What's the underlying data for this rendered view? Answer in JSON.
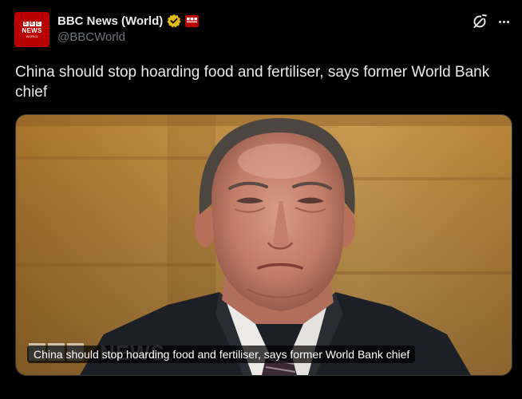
{
  "account": {
    "avatar_blocks": [
      "B",
      "B",
      "C"
    ],
    "avatar_news": "NEWS",
    "avatar_world": "WORLD",
    "display_name": "BBC News (World)",
    "handle": "@BBCWorld"
  },
  "post": {
    "text": "China should stop hoarding food and fertiliser, says former World Bank chief"
  },
  "media": {
    "caption": "China should stop hoarding food and fertiliser, says former World Bank chief",
    "watermark": "NEWS"
  },
  "icons": {
    "verified": "verified-badge-gold-icon",
    "affiliation": "bbc-affiliate-icon",
    "grok": "grok-icon",
    "more": "more-dots-icon"
  },
  "colors": {
    "background": "#000000",
    "text": "#e7e9ea",
    "muted": "#71767b",
    "bbc_red": "#b80000",
    "verified_gold": "#e2b719"
  }
}
